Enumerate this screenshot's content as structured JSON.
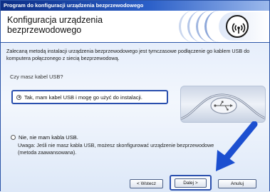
{
  "window": {
    "title": "Program do konfiguracji urządzenia bezprzewodowego"
  },
  "header": {
    "title": "Konfiguracja urządzenia bezprzewodowego",
    "icon": "wifi-icon"
  },
  "main": {
    "description": "Zalecaną metodą instalacji urządzenia bezprzewodowego jest tymczasowe podłączenie go kablem USB do komputera połączonego z siecią bezprzewodową.",
    "question": "Czy masz kabel USB?",
    "option_yes": "Tak, mam kabel USB i mogę go użyć do instalacji.",
    "option_no": "Nie, nie mam kabla USB.",
    "note": "Uwaga: Jeśli nie masz kabla USB, możesz skonfigurować urządzenie bezprzewodowe (metoda zaawansowana).",
    "selected_option": "yes"
  },
  "buttons": {
    "back": "< Wstecz",
    "next": "Dalej >",
    "cancel": "Anuluj"
  },
  "colors": {
    "accent": "#2a4fae",
    "titlebar": "#0d2f86",
    "arrow": "#1c4fd0"
  }
}
